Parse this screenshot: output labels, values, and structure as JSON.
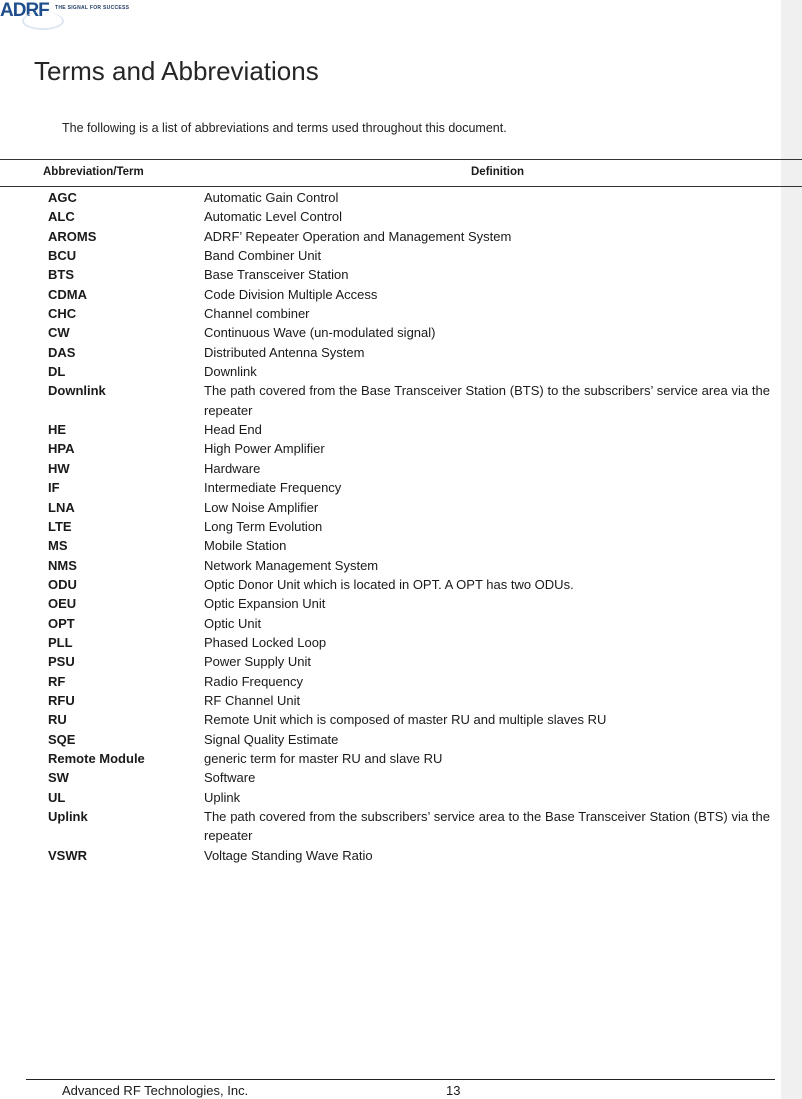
{
  "header": {
    "logo_text": "ADRF",
    "logo_tagline": "THE SIGNAL FOR SUCCESS"
  },
  "title": "Terms and Abbreviations",
  "intro": "The following is a list of abbreviations and terms used throughout this document.",
  "table": {
    "headers": {
      "term": "Abbreviation/Term",
      "definition": "Definition"
    },
    "rows": [
      {
        "term": "AGC",
        "definition": "Automatic Gain Control"
      },
      {
        "term": "ALC",
        "definition": "Automatic Level Control"
      },
      {
        "term": "AROMS",
        "definition": "ADRF’ Repeater Operation and Management System"
      },
      {
        "term": "BCU",
        "definition": "Band Combiner Unit"
      },
      {
        "term": "BTS",
        "definition": "Base Transceiver Station"
      },
      {
        "term": "CDMA",
        "definition": "Code Division Multiple Access"
      },
      {
        "term": "CHC",
        "definition": "Channel combiner"
      },
      {
        "term": "CW",
        "definition": "Continuous Wave (un-modulated signal)"
      },
      {
        "term": "DAS",
        "definition": "Distributed Antenna System"
      },
      {
        "term": "DL",
        "definition": "Downlink"
      },
      {
        "term": "Downlink",
        "definition": "The path covered from the Base Transceiver Station (BTS) to the subscribers’ service area via the repeater"
      },
      {
        "term": "HE",
        "definition": "Head End"
      },
      {
        "term": "HPA",
        "definition": "High Power Amplifier"
      },
      {
        "term": "HW",
        "definition": "Hardware"
      },
      {
        "term": "IF",
        "definition": "Intermediate Frequency"
      },
      {
        "term": "LNA",
        "definition": "Low Noise Amplifier"
      },
      {
        "term": "LTE",
        "definition": "Long Term Evolution"
      },
      {
        "term": "MS",
        "definition": "Mobile Station"
      },
      {
        "term": "NMS",
        "definition": "Network Management System"
      },
      {
        "term": "ODU",
        "definition": "Optic Donor Unit which is located in OPT. A OPT has two ODUs."
      },
      {
        "term": "OEU",
        "definition": "Optic Expansion Unit"
      },
      {
        "term": "OPT",
        "definition": "Optic Unit"
      },
      {
        "term": "PLL",
        "definition": "Phased Locked Loop"
      },
      {
        "term": "PSU",
        "definition": "Power Supply Unit"
      },
      {
        "term": "RF",
        "definition": "Radio Frequency"
      },
      {
        "term": "RFU",
        "definition": "RF Channel Unit"
      },
      {
        "term": "RU",
        "definition": "Remote Unit which is composed of master RU and multiple slaves RU"
      },
      {
        "term": "SQE",
        "definition": "Signal Quality Estimate"
      },
      {
        "term": "Remote Module",
        "definition": "generic term for master RU and slave RU"
      },
      {
        "term": "SW",
        "definition": "Software"
      },
      {
        "term": "UL",
        "definition": "Uplink"
      },
      {
        "term": "Uplink",
        "definition": "The path covered from the subscribers’ service area to the Base Transceiver Station (BTS) via the repeater"
      },
      {
        "term": "VSWR",
        "definition": "Voltage Standing Wave Ratio"
      }
    ]
  },
  "footer": {
    "company": "Advanced RF Technologies, Inc.",
    "page_number": "13"
  }
}
